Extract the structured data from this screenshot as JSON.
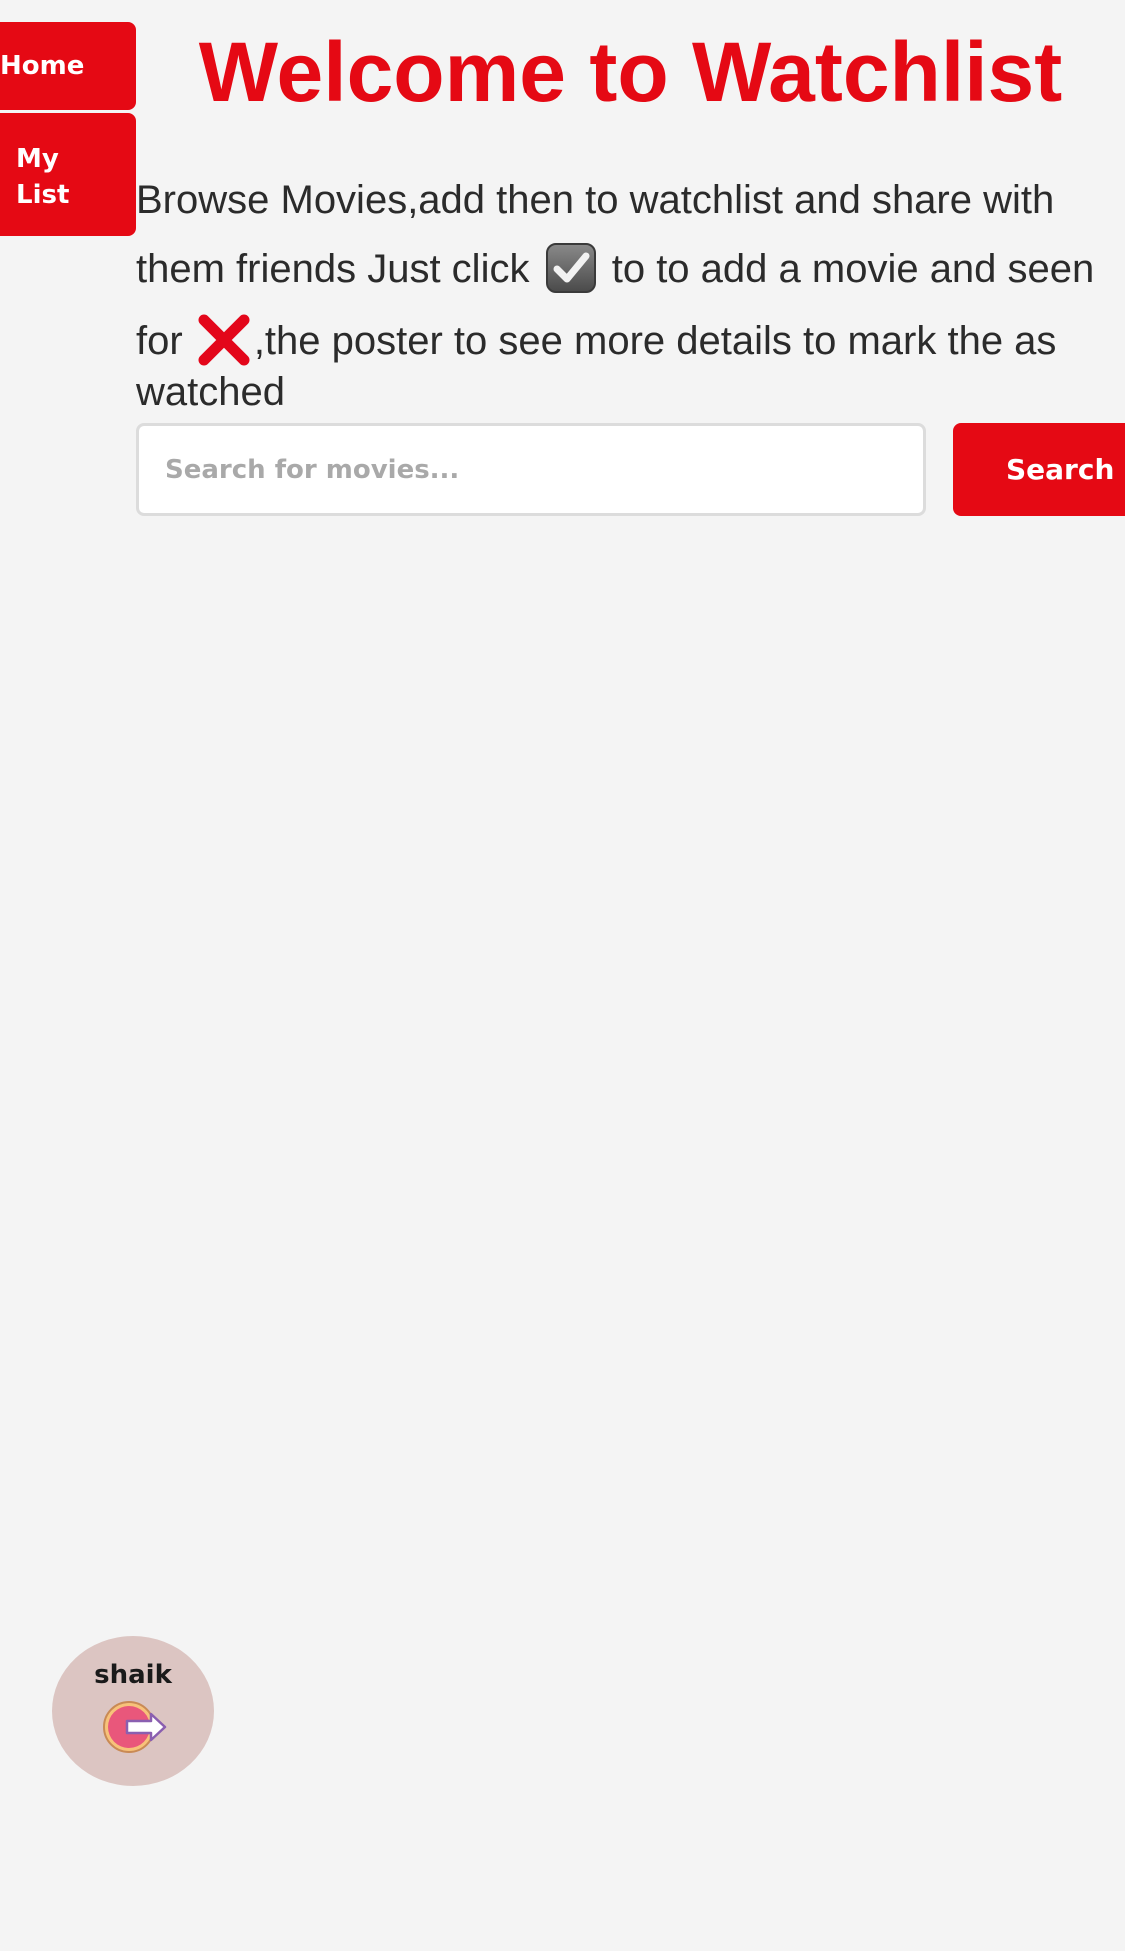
{
  "nav": {
    "items": [
      {
        "label": "Home"
      },
      {
        "label": "My List"
      }
    ]
  },
  "header": {
    "title": "Welcome to Watchlist"
  },
  "intro": {
    "line1": "Browse Movies,add then to watchlist and share with",
    "line2_before": "them friends Just click",
    "line2_after": "to to add a movie and seen",
    "line3_before": "for",
    "line3_after": ",the poster to see more details to mark the as",
    "line4": "watched"
  },
  "search": {
    "placeholder": "Search for movies...",
    "value": "",
    "button_label": "Search"
  },
  "user": {
    "name": "shaik",
    "logout_icon": "logout-icon"
  },
  "colors": {
    "accent": "#e50914",
    "background": "#f4f4f4",
    "text": "#2b2b2b",
    "user_badge": "#dcc5c2"
  }
}
